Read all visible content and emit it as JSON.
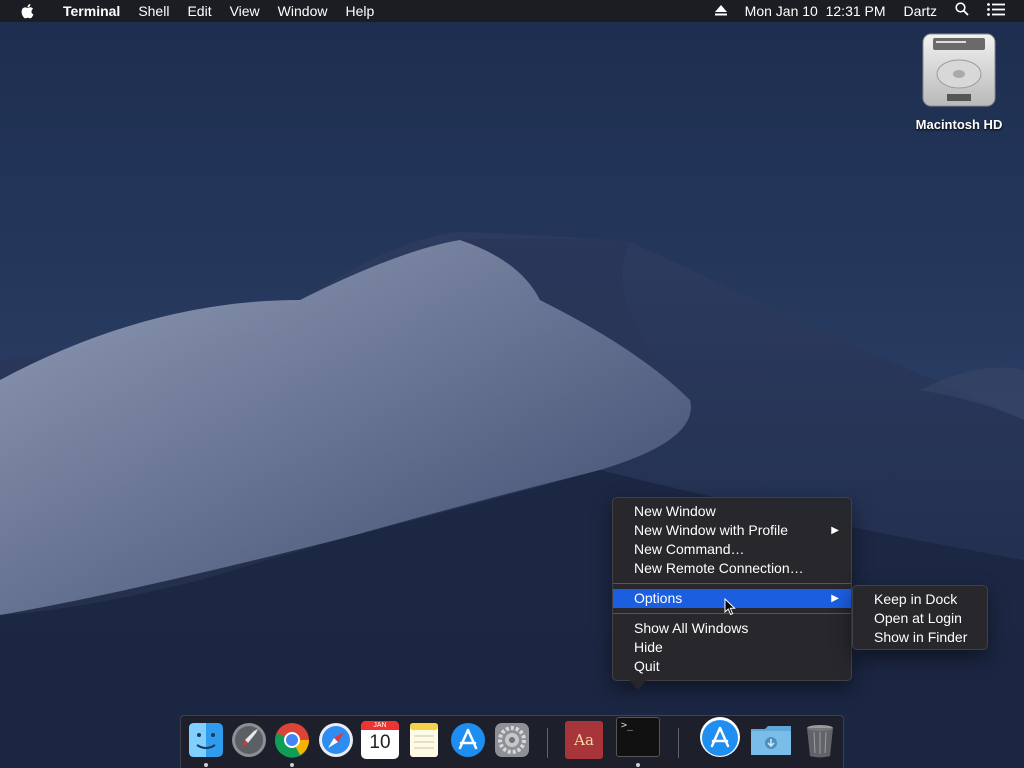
{
  "menubar": {
    "app_name": "Terminal",
    "menus": [
      "Shell",
      "Edit",
      "View",
      "Window",
      "Help"
    ],
    "clock": "Mon Jan 10  12:31 PM",
    "user": "Dartz"
  },
  "desktop": {
    "drive_label": "Macintosh HD"
  },
  "context_menu": {
    "items": [
      {
        "label": "New Window"
      },
      {
        "label": "New Window with Profile"
      },
      {
        "label": "New Command…"
      },
      {
        "label": "New Remote Connection…"
      },
      {
        "label": "Options"
      },
      {
        "label": "Show All Windows"
      },
      {
        "label": "Hide"
      },
      {
        "label": "Quit"
      }
    ],
    "highlight_color": "#1b5ee0"
  },
  "options_submenu": {
    "items": [
      {
        "label": "Keep in Dock"
      },
      {
        "label": "Open at Login"
      },
      {
        "label": "Show in Finder"
      }
    ]
  },
  "dock": {
    "calendar_month": "JAN",
    "calendar_day": "10",
    "dictionary_glyph": "Aa",
    "terminal_prompt": ">_",
    "apps": [
      "finder-icon",
      "launchpad-icon",
      "chrome-icon",
      "safari-icon",
      "calendar-icon",
      "notes-icon",
      "app-store-icon",
      "system-preferences-icon",
      "dictionary-icon",
      "terminal-icon",
      "app-store-download-icon",
      "downloads-folder-icon",
      "trash-icon"
    ]
  }
}
